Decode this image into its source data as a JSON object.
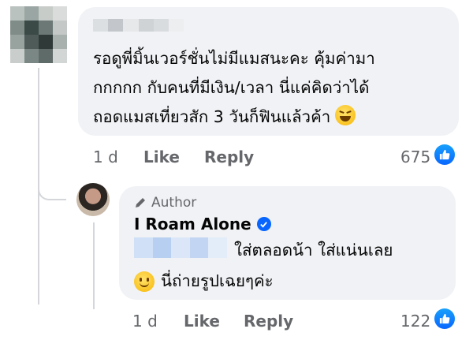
{
  "comment": {
    "text_lines": [
      "รอดูพี่มิ้นเวอร์ชั่นไม่มีแมสนะคะ คุ้มค่ามา",
      "กกกกก กับคนที่มีเงิน/เวลา นี่แค่คิดว่าได้",
      "ถอดแมสเที่ยวสัก 3 วันก็ฟินแล้วค้า"
    ],
    "time": "1 d",
    "like_label": "Like",
    "reply_label": "Reply",
    "reaction_count": "675"
  },
  "reply": {
    "author_badge": "Author",
    "author_name": "I Roam Alone",
    "text_line1": "ใส่ตลอดน้า ใส่แน่นเลย",
    "text_line2": "นี่ถ่ายรูปเฉยๆค่ะ",
    "time": "1 d",
    "like_label": "Like",
    "reply_label": "Reply",
    "reaction_count": "122"
  },
  "icons": {
    "reaction": "like-thumb-icon",
    "author_badge": "pencil-icon",
    "verified": "verified-check-icon",
    "emoji_comment": "laughing-face-emoji",
    "emoji_reply": "smiling-face-emoji"
  },
  "colors": {
    "bubble": "#f0f2f5",
    "secondary_text": "#65676b",
    "like_blue": "#0866ff"
  }
}
